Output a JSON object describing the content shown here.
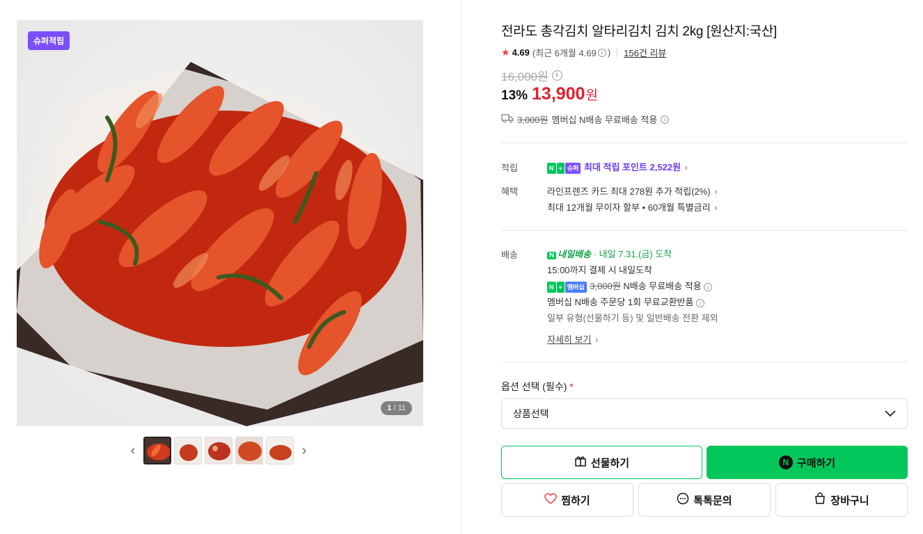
{
  "gallery": {
    "badge": "슈퍼적립",
    "counter_current": "1",
    "counter_total": "/ 11",
    "thumb_count": 5
  },
  "product": {
    "title": "전라도 총각김치 알타리김치 김치 2kg [원산지:국산]",
    "rating_score": "4.69",
    "rating_recent": "(최근 6개월 4.69",
    "rating_recent_close": ")",
    "review_link": "156건 리뷰",
    "original_price": "16,000원",
    "discount_pct": "13%",
    "sale_price": "13,900",
    "currency": "원",
    "shipping_old": "3,000원",
    "shipping_text": "멤버십 N배송 무료배송 적용"
  },
  "benefits": {
    "points_label": "적립",
    "points_n": "N",
    "points_plus": "+",
    "points_super": "슈퍼",
    "points_text": "최대 적립 포인트",
    "points_value": "2,522원",
    "benefit_label": "혜택",
    "benefit_1": "라인프렌즈 카드 최대 278원 추가 적립(2%)",
    "benefit_2": "최대 12개월 무이자 할부 • 60개월 특별금리"
  },
  "delivery": {
    "label": "배송",
    "badge": "내일배송",
    "arrival": "· 내일 7.31.(금) 도착",
    "cutoff": "15:00까지 결제 시 내일도착",
    "member_badge_n": "N",
    "member_badge_plus": "+",
    "member_badge": "멤버십",
    "member_old": "3,000원",
    "member_text": "N배송 무료배송 적용",
    "exchange": "멤버십 N배송 주문당 1회 무료교환반품",
    "exclusion": "일부 유형(선물하기 등) 및 일반배송 전환 제외",
    "more": "자세히 보기"
  },
  "options": {
    "label": "옵션 선택 (필수)",
    "required_mark": "*",
    "select_placeholder": "상품선택"
  },
  "buttons": {
    "gift": "선물하기",
    "buy": "구매하기",
    "wish": "찜하기",
    "talk": "톡톡문의",
    "cart": "장바구니"
  },
  "colors": {
    "accent_green": "#03c75a",
    "price_red": "#e0202f",
    "super_purple": "#7b4fff"
  }
}
